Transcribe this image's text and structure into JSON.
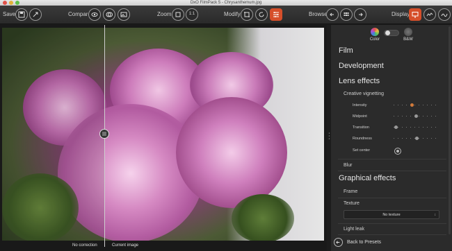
{
  "window": {
    "title": "DxO FilmPack 5 - Chrysanthemum.jpg"
  },
  "toolbar": {
    "save_label": "Save",
    "compare_label": "Compare",
    "zoom_label": "Zoom",
    "zoom_one_to_one": "1:1",
    "modify_label": "Modify",
    "browse_label": "Browse",
    "display_label": "Display"
  },
  "image": {
    "left_caption": "No correction",
    "right_caption": "Current image"
  },
  "panel": {
    "modes": {
      "color": "Color",
      "bw": "B&W"
    },
    "sections": {
      "film": "Film",
      "development": "Development",
      "lens_effects": "Lens effects",
      "creative_vignetting": "Creative vignetting",
      "blur": "Blur",
      "graphical_effects": "Graphical effects",
      "frame": "Frame",
      "texture": "Texture",
      "light_leak": "Light leak"
    },
    "vignetting_params": {
      "intensity": "Intensity",
      "midpoint": "Midpoint",
      "transition": "Transition",
      "roundness": "Roundness",
      "set_center": "Set center"
    },
    "texture_select": {
      "value": "No texture"
    },
    "back_label": "Back to Presets"
  },
  "colors": {
    "accent": "#e0522a",
    "panel_bg": "#2b2b2b",
    "toolbar_bg": "#333333"
  }
}
